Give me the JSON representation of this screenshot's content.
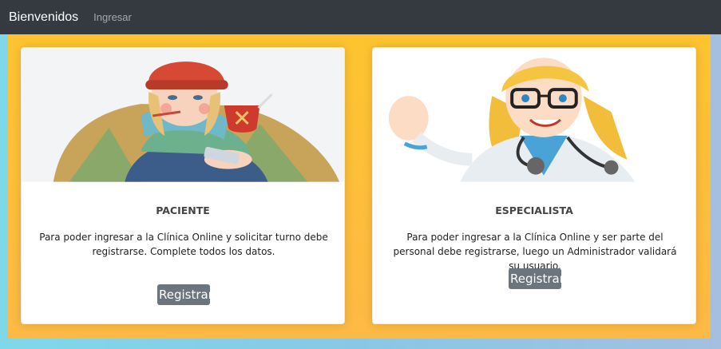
{
  "navbar": {
    "brand": "Bienvenidos",
    "link_ingresar": "Ingresar"
  },
  "cards": [
    {
      "title": "PACIENTE",
      "text": "Para poder ingresar a la Clínica Online y solicitar turno debe registrarse. Complete todos los datos.",
      "button": "Registrar",
      "image": "sick-patient-illustration"
    },
    {
      "title": "ESPECIALISTA",
      "text": "Para poder ingresar a la Clínica Online y ser parte del personal debe registrarse, luego un Administrador validará su usuario.",
      "button": "Registrar",
      "image": "doctor-illustration"
    }
  ],
  "colors": {
    "navbar": "#343a40",
    "panel": "#fec42f",
    "button": "#6c757d",
    "background": "#7fd8ea"
  }
}
